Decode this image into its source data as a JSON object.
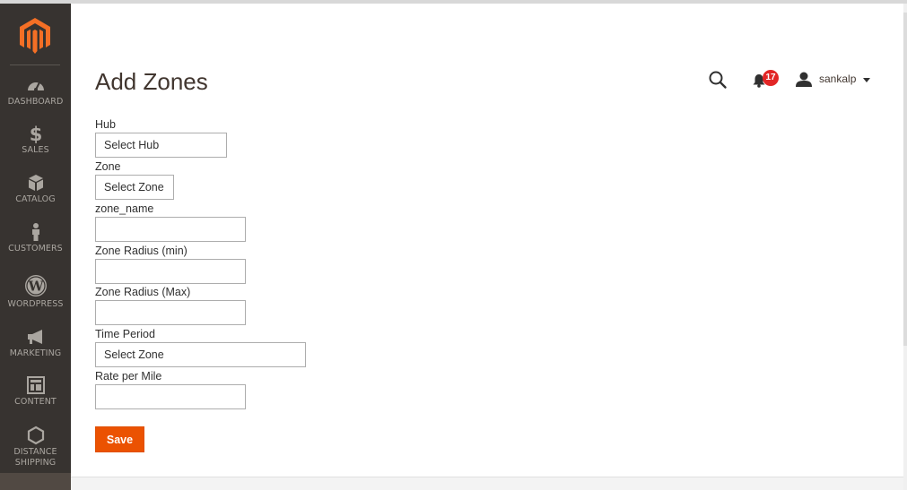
{
  "sidebar": {
    "items": [
      {
        "label": "DASHBOARD",
        "icon": "dashboard-gauge-icon"
      },
      {
        "label": "SALES",
        "icon": "dollar-icon"
      },
      {
        "label": "CATALOG",
        "icon": "cube-icon"
      },
      {
        "label": "CUSTOMERS",
        "icon": "person-icon"
      },
      {
        "label": "WORDPRESS",
        "icon": "wordpress-icon"
      },
      {
        "label": "MARKETING",
        "icon": "megaphone-icon"
      },
      {
        "label": "CONTENT",
        "icon": "layout-icon"
      },
      {
        "label": "DISTANCE SHIPPING",
        "icon": "hexagon-icon"
      }
    ]
  },
  "header": {
    "title": "Add Zones",
    "notifications_count": "17",
    "username": "sankalp"
  },
  "form": {
    "hub_label": "Hub",
    "hub_value": "Select Hub",
    "zone_label": "Zone",
    "zone_value": "Select Zone",
    "zone_name_label": "zone_name",
    "zone_name_value": "",
    "radius_min_label": "Zone Radius (min)",
    "radius_min_value": "",
    "radius_max_label": "Zone Radius (Max)",
    "radius_max_value": "",
    "time_period_label": "Time Period",
    "time_period_value": "Select Zone",
    "rate_label": "Rate per Mile",
    "rate_value": "",
    "save_label": "Save"
  },
  "colors": {
    "sidebar_bg": "#373330",
    "brand_orange": "#eb5202",
    "badge_red": "#e22626",
    "logo_orange": "#f46f25"
  }
}
